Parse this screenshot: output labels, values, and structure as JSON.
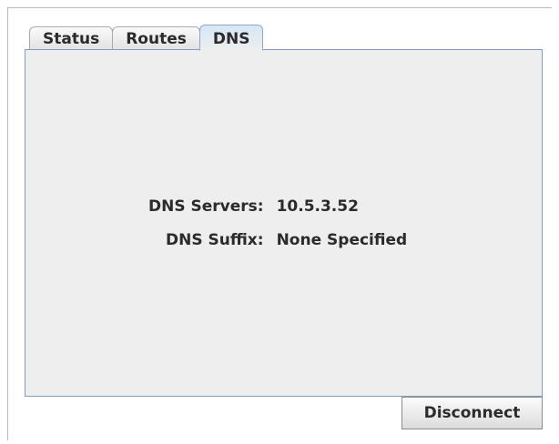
{
  "tabs": [
    {
      "label": "Status",
      "active": false
    },
    {
      "label": "Routes",
      "active": false
    },
    {
      "label": "DNS",
      "active": true
    }
  ],
  "dns": {
    "servers_label": "DNS Servers:",
    "servers_value": "10.5.3.52",
    "suffix_label": "DNS Suffix:",
    "suffix_value": "None Specified"
  },
  "footer": {
    "disconnect_label": "Disconnect"
  }
}
